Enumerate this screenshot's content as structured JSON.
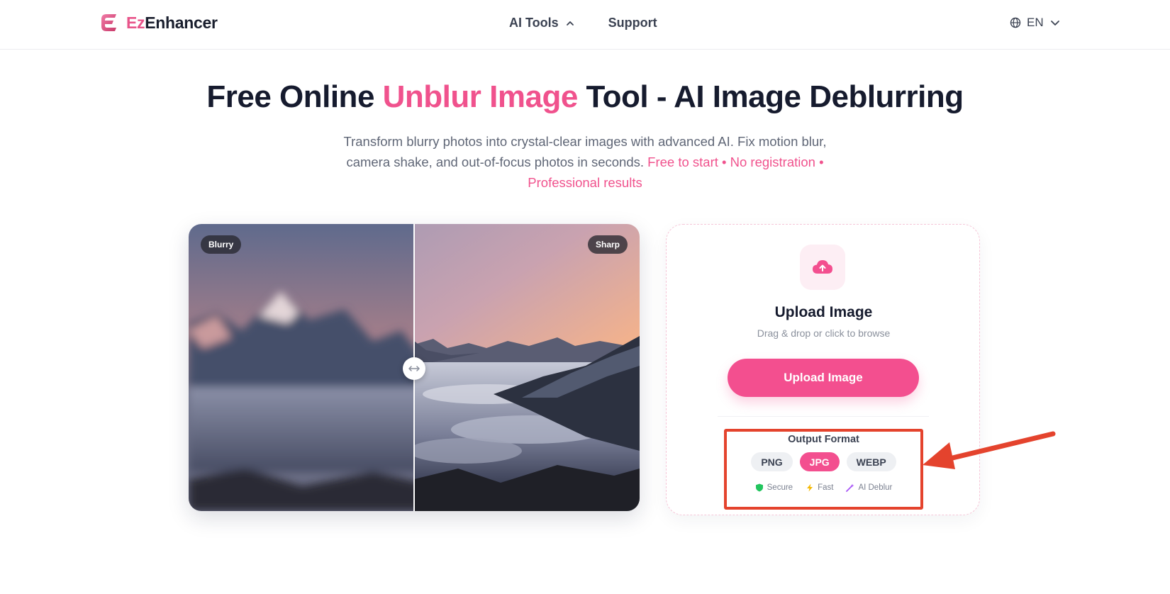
{
  "header": {
    "logo": {
      "ez": "Ez",
      "rest": "Enhancer"
    },
    "nav": [
      {
        "label": "AI Tools",
        "icon": "chevron-up-icon"
      },
      {
        "label": "Support"
      }
    ],
    "language": {
      "label": "EN",
      "icon": "globe-icon"
    }
  },
  "hero": {
    "title_before": "Free Online ",
    "title_accent": "Unblur Image",
    "title_after": " Tool - AI Image Deblurring",
    "subtitle_plain": "Transform blurry photos into crystal-clear images with advanced AI. Fix motion blur, camera shake, and out-of-focus photos in seconds. ",
    "subtitle_highlight": "Free to start • No registration • Professional results"
  },
  "compare": {
    "left_label": "Blurry",
    "right_label": "Sharp"
  },
  "upload": {
    "title": "Upload Image",
    "hint": "Drag & drop or click to browse",
    "button_label": "Upload Image",
    "format_label": "Output Format",
    "formats": [
      "PNG",
      "JPG",
      "WEBP"
    ],
    "selected_format": "JPG",
    "features": [
      {
        "label": "Secure",
        "icon": "shield-icon",
        "color": "#22c55e"
      },
      {
        "label": "Fast",
        "icon": "lightning-icon",
        "color": "#f5b800"
      },
      {
        "label": "AI Deblur",
        "icon": "magic-wand-icon",
        "color": "#a855f7"
      }
    ]
  },
  "colors": {
    "accent": "#f0528d",
    "annotation": "#e4432d"
  }
}
